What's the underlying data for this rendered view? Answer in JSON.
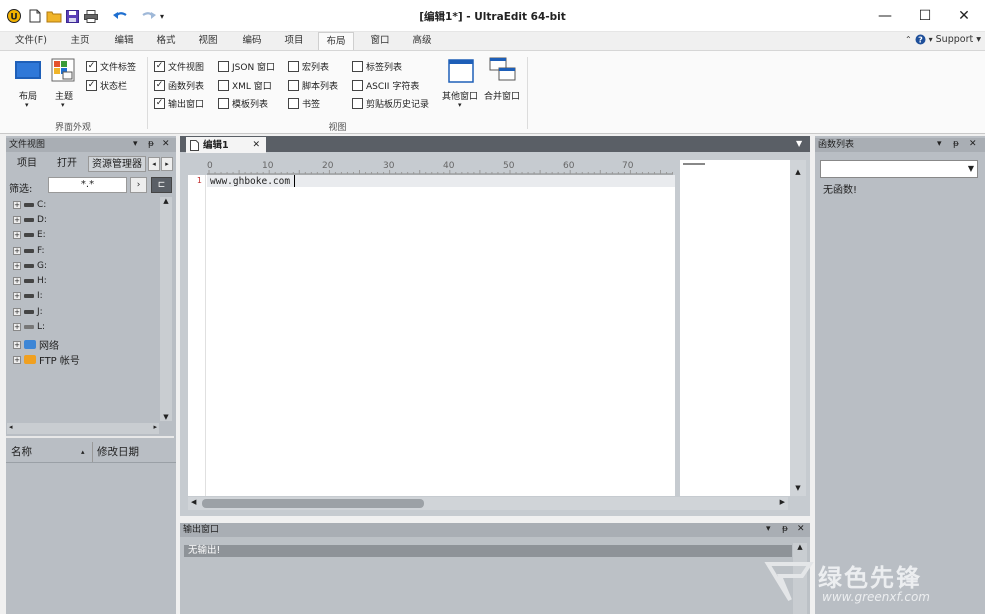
{
  "window": {
    "title": "[编辑1*] - UltraEdit 64-bit",
    "minimize_glyph": "—",
    "maximize_glyph": "☐",
    "close_glyph": "✕"
  },
  "menu_tabs": [
    "文件(F)",
    "主页",
    "编辑",
    "格式",
    "视图",
    "编码",
    "项目",
    "布局",
    "窗口",
    "高级"
  ],
  "active_tab": "布局",
  "support": {
    "label": "Support",
    "caret": "▾"
  },
  "ribbon": {
    "layout_button": "布局",
    "theme_button": "主题",
    "group_appearance": "界面外观",
    "group_view": "视图",
    "appearance_checks": [
      {
        "label": "文件标签",
        "checked": true
      },
      {
        "label": "状态栏",
        "checked": true
      }
    ],
    "view_checks_col1": [
      {
        "label": "文件视图",
        "checked": true
      },
      {
        "label": "函数列表",
        "checked": true
      },
      {
        "label": "输出窗口",
        "checked": true
      }
    ],
    "view_checks_col2": [
      {
        "label": "JSON 窗口",
        "checked": false
      },
      {
        "label": "XML 窗口",
        "checked": false
      },
      {
        "label": "模板列表",
        "checked": false
      }
    ],
    "view_checks_col3": [
      {
        "label": "宏列表",
        "checked": false
      },
      {
        "label": "脚本列表",
        "checked": false
      },
      {
        "label": "书签",
        "checked": false
      }
    ],
    "view_checks_col4": [
      {
        "label": "标签列表",
        "checked": false
      },
      {
        "label": "ASCII 字符表",
        "checked": false
      },
      {
        "label": "剪贴板历史记录",
        "checked": false
      }
    ],
    "other_windows": "其他窗口",
    "merge_windows": "合并窗口"
  },
  "file_view": {
    "title": "文件视图",
    "tabs": [
      "项目",
      "打开",
      "资源管理器"
    ],
    "filter_label": "筛选:",
    "filter_value": "*.*",
    "drives": [
      "C:",
      "D:",
      "E:",
      "F:",
      "G:",
      "H:",
      "I:",
      "J:",
      "L:"
    ],
    "network": "网络",
    "ftp": "FTP 帐号",
    "col_name": "名称",
    "col_modified": "修改日期"
  },
  "editor": {
    "tab": "编辑1",
    "ruler_marks": [
      "0",
      "10",
      "20",
      "30",
      "40",
      "50",
      "60",
      "70"
    ],
    "line_number": "1",
    "line1": "www.ghboke.com"
  },
  "function_list": {
    "title": "函数列表",
    "empty": "无函数!"
  },
  "output": {
    "title": "输出窗口",
    "text": "无输出!"
  },
  "watermark": {
    "brand": "绿色先锋",
    "url": "www.greenxf.com"
  },
  "colors": {
    "panel_bg": "#b9bec4",
    "panel_header": "#a9aeb4",
    "accent_blue": "#1e6fd0"
  }
}
